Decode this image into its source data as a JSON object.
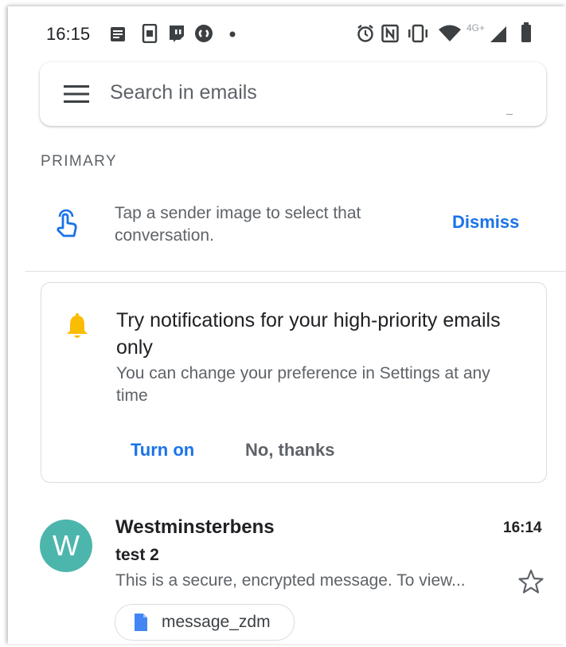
{
  "status_bar": {
    "time": "16:15",
    "network_label": "4G+",
    "left_icons": [
      "notes-icon",
      "bank-app-icon",
      "twitch-icon",
      "shazam-icon",
      "dot-icon"
    ],
    "right_icons": [
      "alarm-icon",
      "nfc-icon",
      "vibrate-icon",
      "wifi-icon",
      "signal-icon",
      "battery-icon"
    ]
  },
  "search": {
    "placeholder": "Search in emails",
    "menu_icon": "hamburger-menu-icon"
  },
  "section": {
    "label": "PRIMARY"
  },
  "tip": {
    "icon": "touch-icon",
    "text": "Tap a sender image to select that conversation.",
    "dismiss_label": "Dismiss"
  },
  "notification_card": {
    "icon": "bell-icon",
    "title": "Try notifications for your high-priority emails only",
    "description": "You can change your preference in Settings at any time",
    "turn_on_label": "Turn on",
    "no_thanks_label": "No, thanks"
  },
  "emails": [
    {
      "avatar_letter": "W",
      "sender": "Westminsterbens",
      "time": "16:14",
      "subject": "test 2",
      "snippet": "This is a secure, encrypted message. To view...",
      "attachment": "message_zdm",
      "starred": false
    }
  ],
  "colors": {
    "accent": "#1a73e8",
    "avatar": "#4db6ac",
    "bell": "#fbbc04",
    "doc_icon": "#4285f4"
  }
}
